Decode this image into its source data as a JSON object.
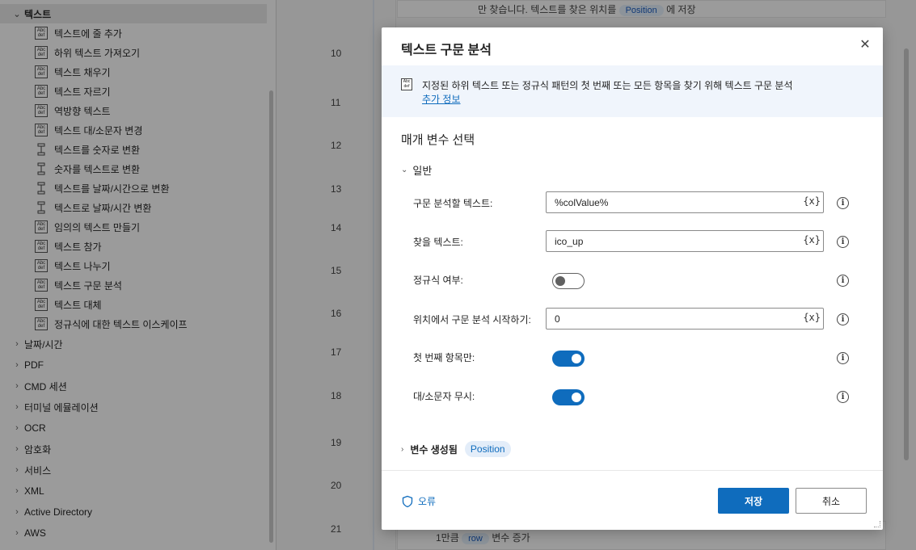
{
  "sidebar": {
    "expanded_group": "텍스트",
    "items": [
      {
        "label": "텍스트에 줄 추가",
        "icon": "abc-def-icon"
      },
      {
        "label": "하위 텍스트 가져오기",
        "icon": "abc-def-icon"
      },
      {
        "label": "텍스트 채우기",
        "icon": "abc-def-icon"
      },
      {
        "label": "텍스트 자르기",
        "icon": "abc-def-icon"
      },
      {
        "label": "역방향 텍스트",
        "icon": "abc-def-icon"
      },
      {
        "label": "텍스트 대/소문자 변경",
        "icon": "abc-def-icon"
      },
      {
        "label": "텍스트를 숫자로 변환",
        "icon": "convert-icon"
      },
      {
        "label": "숫자를 텍스트로 변환",
        "icon": "convert-icon"
      },
      {
        "label": "텍스트를 날짜/시간으로 변환",
        "icon": "convert-icon"
      },
      {
        "label": "텍스트로 날짜/시간 변환",
        "icon": "convert-icon"
      },
      {
        "label": "임의의 텍스트 만들기",
        "icon": "abc-def-icon"
      },
      {
        "label": "텍스트 참가",
        "icon": "abc-def-icon"
      },
      {
        "label": "텍스트 나누기",
        "icon": "abc-def-icon"
      },
      {
        "label": "텍스트 구문 분석",
        "icon": "abc-def-icon"
      },
      {
        "label": "텍스트 대체",
        "icon": "abc-def-icon"
      },
      {
        "label": "정규식에 대한 텍스트 이스케이프",
        "icon": "abc-def-icon"
      }
    ],
    "groups": [
      "날짜/시간",
      "PDF",
      "CMD 세션",
      "터미널 에뮬레이션",
      "OCR",
      "암호화",
      "서비스",
      "XML",
      "Active Directory",
      "AWS"
    ]
  },
  "flow": {
    "line_numbers": [
      "10",
      "11",
      "12",
      "13",
      "14",
      "15",
      "16",
      "17",
      "18",
      "19",
      "20",
      "21"
    ],
    "top_text": "만 찾습니다. 텍스트를 찾은 위치를",
    "top_pill": "Position",
    "top_suffix": "에 저장",
    "bottom_text_prefix": "1만큼",
    "bottom_pill": "row",
    "bottom_text_suffix": "변수 증가"
  },
  "dialog": {
    "title": "텍스트 구문 분석",
    "description": "지정된 하위 텍스트 또는 정규식 패턴의 첫 번째 또는 모든 항목을 찾기 위해 텍스트 구문 분석",
    "more_info": "추가 정보",
    "section_title": "매개 변수 선택",
    "group_label": "일반",
    "params": {
      "text_to_parse": {
        "label": "구문 분석할 텍스트:",
        "value": "%colValue%"
      },
      "text_to_find": {
        "label": "찾을 텍스트:",
        "value": "ico_up"
      },
      "is_regex": {
        "label": "정규식 여부:",
        "on": false
      },
      "start_position": {
        "label": "위치에서 구문 분석 시작하기:",
        "value": "0"
      },
      "first_only": {
        "label": "첫 번째 항목만:",
        "on": true
      },
      "ignore_case": {
        "label": "대/소문자 무시:",
        "on": true
      }
    },
    "var_button": "{x}",
    "variables_label": "변수 생성됨",
    "variables_pill": "Position",
    "error_label": "오류",
    "save_label": "저장",
    "cancel_label": "취소"
  },
  "colors": {
    "accent": "#0f6cbd",
    "pill_bg": "#e3edf9"
  }
}
